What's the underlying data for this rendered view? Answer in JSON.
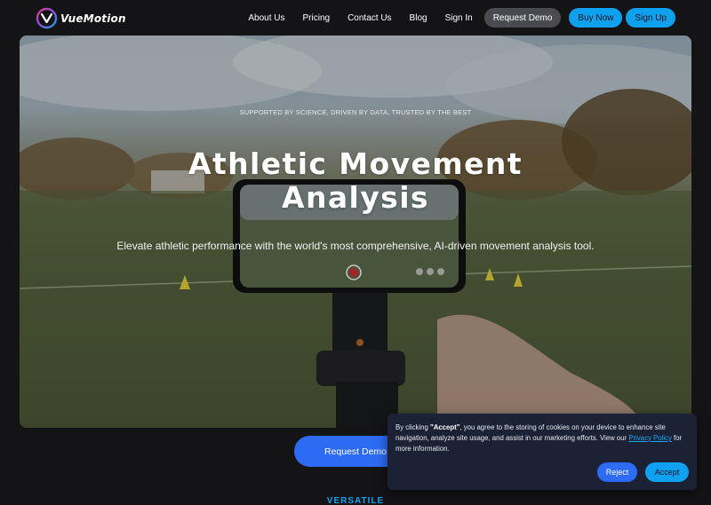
{
  "nav": {
    "logo_text": "VueMotion",
    "links": [
      "About Us",
      "Pricing",
      "Contact Us",
      "Blog",
      "Sign In"
    ],
    "request_demo": "Request Demo",
    "buy_now": "Buy Now",
    "sign_up": "Sign Up"
  },
  "hero": {
    "tagline": "SUPPORTED BY SCIENCE, DRIVEN BY DATA, TRUSTED BY THE BEST",
    "title": "Athletic Movement Analysis",
    "subtitle": "Elevate athletic performance with the world's most comprehensive, AI-driven movement analysis tool."
  },
  "cta": {
    "request_demo": "Request Demo"
  },
  "section": {
    "label": "VERSATILE"
  },
  "cookie": {
    "text_before": "By clicking ",
    "text_bold": "\"Accept\"",
    "text_middle": ", you agree to the storing of cookies on your device to enhance site navigation, analyze site usage, and assist in our marketing efforts. View our ",
    "link": "Privacy Policy",
    "text_after": " for more information.",
    "reject": "Reject",
    "accept": "Accept"
  },
  "colors": {
    "background": "#141416",
    "accent_blue": "#0fa1ef",
    "primary_blue": "#2d6bf5",
    "cookie_bg": "#1c2236"
  },
  "icons": {
    "logo": "vuemotion-logo-icon"
  }
}
